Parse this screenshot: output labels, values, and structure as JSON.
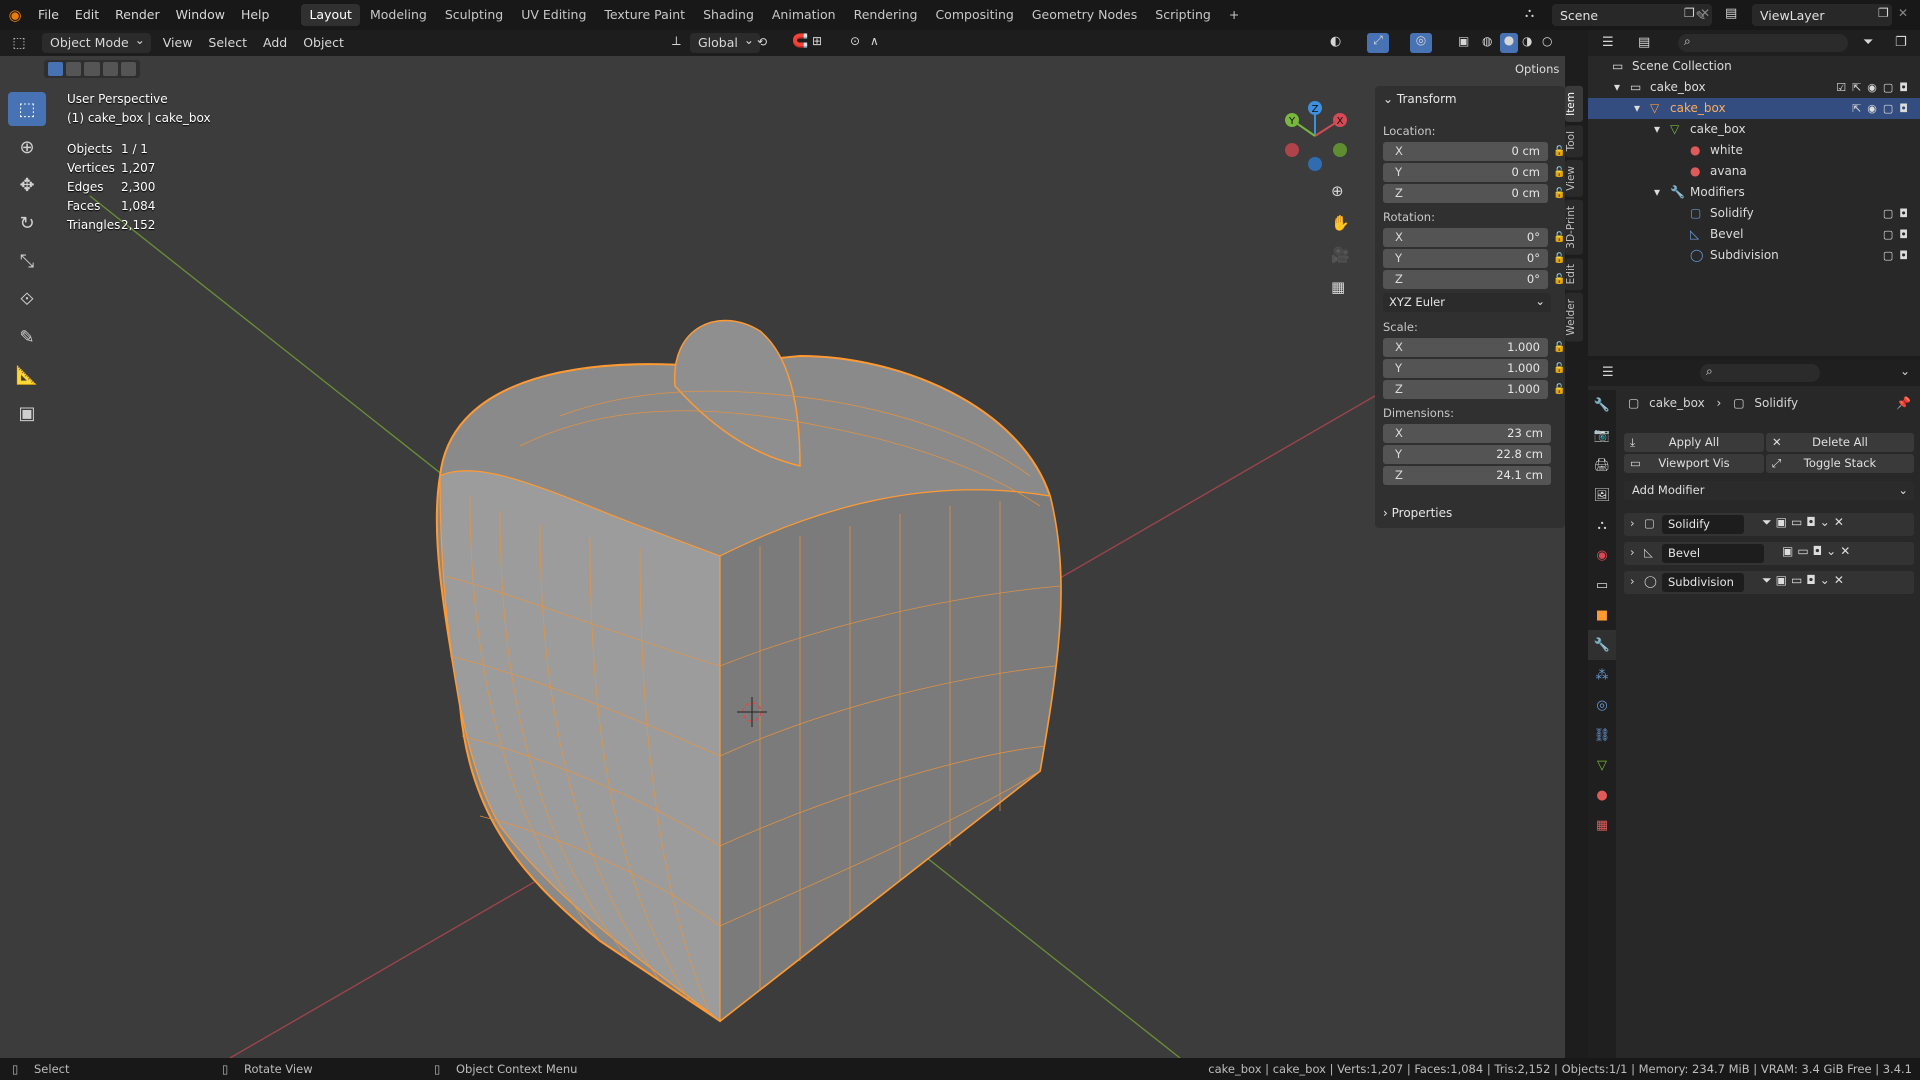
{
  "topbar": {
    "menus": [
      "File",
      "Edit",
      "Render",
      "Window",
      "Help"
    ],
    "workspaces": [
      "Layout",
      "Modeling",
      "Sculpting",
      "UV Editing",
      "Texture Paint",
      "Shading",
      "Animation",
      "Rendering",
      "Compositing",
      "Geometry Nodes",
      "Scripting"
    ],
    "add_tab": "+",
    "scene": "Scene",
    "view_layer": "ViewLayer"
  },
  "viewport_header": {
    "mode": "Object Mode",
    "menus": [
      "View",
      "Select",
      "Add",
      "Object"
    ],
    "orientation": "Global",
    "options": "Options"
  },
  "viewport": {
    "view_name": "User Perspective",
    "object_line": "(1) cake_box | cake_box",
    "stats": [
      {
        "label": "Objects",
        "value": "1 / 1"
      },
      {
        "label": "Vertices",
        "value": "1,207"
      },
      {
        "label": "Edges",
        "value": "2,300"
      },
      {
        "label": "Faces",
        "value": "1,084"
      },
      {
        "label": "Triangles",
        "value": "2,152"
      }
    ],
    "gizmo": {
      "x": "X",
      "y": "Y",
      "z": "Z"
    }
  },
  "npanel": {
    "transform_title": "Transform",
    "location_label": "Location:",
    "location": [
      {
        "axis": "X",
        "value": "0 cm"
      },
      {
        "axis": "Y",
        "value": "0 cm"
      },
      {
        "axis": "Z",
        "value": "0 cm"
      }
    ],
    "rotation_label": "Rotation:",
    "rotation": [
      {
        "axis": "X",
        "value": "0°"
      },
      {
        "axis": "Y",
        "value": "0°"
      },
      {
        "axis": "Z",
        "value": "0°"
      }
    ],
    "rotation_mode": "XYZ Euler",
    "scale_label": "Scale:",
    "scale": [
      {
        "axis": "X",
        "value": "1.000"
      },
      {
        "axis": "Y",
        "value": "1.000"
      },
      {
        "axis": "Z",
        "value": "1.000"
      }
    ],
    "dimensions_label": "Dimensions:",
    "dimensions": [
      {
        "axis": "X",
        "value": "23 cm"
      },
      {
        "axis": "Y",
        "value": "22.8 cm"
      },
      {
        "axis": "Z",
        "value": "24.1 cm"
      }
    ],
    "properties_title": "Properties",
    "tabs": [
      "Item",
      "Tool",
      "View",
      "3D-Print",
      "Edit",
      "Welder"
    ]
  },
  "outliner": {
    "rows": [
      {
        "label": "Scene Collection"
      },
      {
        "label": "cake_box"
      },
      {
        "label": "cake_box"
      },
      {
        "label": "cake_box"
      },
      {
        "label": "white"
      },
      {
        "label": "avana"
      },
      {
        "label": "Modifiers"
      },
      {
        "label": "Solidify"
      },
      {
        "label": "Bevel"
      },
      {
        "label": "Subdivision"
      }
    ]
  },
  "properties": {
    "breadcrumb_object": "cake_box",
    "breadcrumb_modifier": "Solidify",
    "apply_all": "Apply All",
    "delete_all": "Delete All",
    "viewport_vis": "Viewport Vis",
    "toggle_stack": "Toggle Stack",
    "add_modifier": "Add Modifier",
    "modifiers": [
      {
        "name": "Solidify"
      },
      {
        "name": "Bevel"
      },
      {
        "name": "Subdivision"
      }
    ]
  },
  "statusbar": {
    "select": "Select",
    "rotate": "Rotate View",
    "context": "Object Context Menu",
    "info": "cake_box | cake_box | Verts:1,207 | Faces:1,084 | Tris:2,152 | Objects:1/1 | Memory: 234.7 MiB | VRAM: 3.4 GiB Free | 3.4.1"
  },
  "colors": {
    "accent": "#4772b3",
    "selection_orange": "#ffa040",
    "x_axis": "#d64a55",
    "y_axis": "#78b83c",
    "z_axis": "#3d8fe0"
  }
}
